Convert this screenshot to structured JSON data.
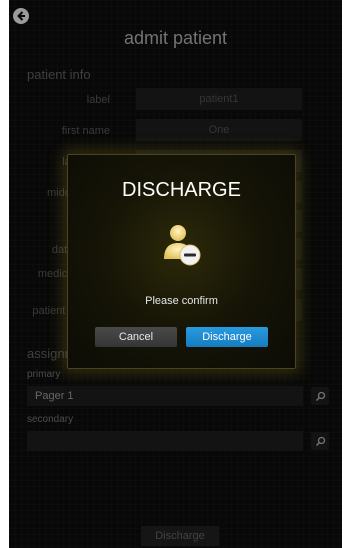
{
  "header": {
    "title": "admit patient"
  },
  "patient_info": {
    "section_title": "patient info",
    "fields": [
      {
        "label": "label",
        "value": "patient1"
      },
      {
        "label": "first name",
        "value": "One"
      },
      {
        "label": "last name",
        "value": ""
      },
      {
        "label": "middle name",
        "value": ""
      },
      {
        "label": "sex",
        "value": ""
      },
      {
        "label": "date of birth",
        "value": ""
      },
      {
        "label": "medical record number",
        "value": ""
      },
      {
        "label": "patient identifier",
        "value": ""
      }
    ]
  },
  "assignments": {
    "section_title": "assignments",
    "primary_label": "primary",
    "primary_value": "Pager 1",
    "secondary_label": "secondary",
    "secondary_value": ""
  },
  "footer": {
    "discharge_label": "Discharge"
  },
  "modal": {
    "title": "DISCHARGE",
    "message": "Please confirm",
    "cancel_label": "Cancel",
    "confirm_label": "Discharge",
    "accent_color": "#1f8fd6",
    "icon": "user-remove-icon"
  }
}
